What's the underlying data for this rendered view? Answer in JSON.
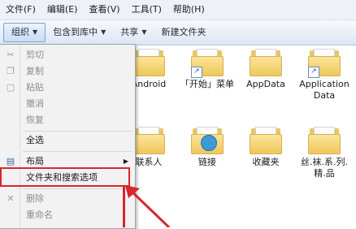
{
  "menubar": {
    "items": [
      "文件(F)",
      "编辑(E)",
      "查看(V)",
      "工具(T)",
      "帮助(H)"
    ]
  },
  "toolbar": {
    "organize": "组织",
    "include_library": "包含到库中",
    "share": "共享",
    "new_folder": "新建文件夹"
  },
  "folders": [
    {
      "label": "Android"
    },
    {
      "label": "「开始」菜单"
    },
    {
      "label": "AppData"
    },
    {
      "label": "Application Data"
    },
    {
      "label": "联系人"
    },
    {
      "label": "链接"
    },
    {
      "label": "收藏夹"
    },
    {
      "label": "丝.袜.系.列.精.品"
    }
  ],
  "context_menu": {
    "items": [
      {
        "label": "剪切",
        "icon": "scissors-icon",
        "enabled": false
      },
      {
        "label": "复制",
        "icon": "copy-icon",
        "enabled": false
      },
      {
        "label": "粘贴",
        "icon": "paste-icon",
        "enabled": false
      },
      {
        "label": "撤消",
        "enabled": false
      },
      {
        "label": "恢复",
        "enabled": false
      },
      {
        "label": "全选",
        "enabled": true
      },
      {
        "label": "布局",
        "icon": "layout-icon",
        "enabled": true,
        "submenu": true
      },
      {
        "label": "文件夹和搜索选项",
        "enabled": true,
        "highlighted": true
      },
      {
        "label": "删除",
        "icon": "delete-x-icon",
        "enabled": false
      },
      {
        "label": "重命名",
        "enabled": false
      }
    ]
  },
  "colors": {
    "highlight": "#d8262b",
    "folder": "#efc85c",
    "menu_background": "#f2f2f2"
  }
}
